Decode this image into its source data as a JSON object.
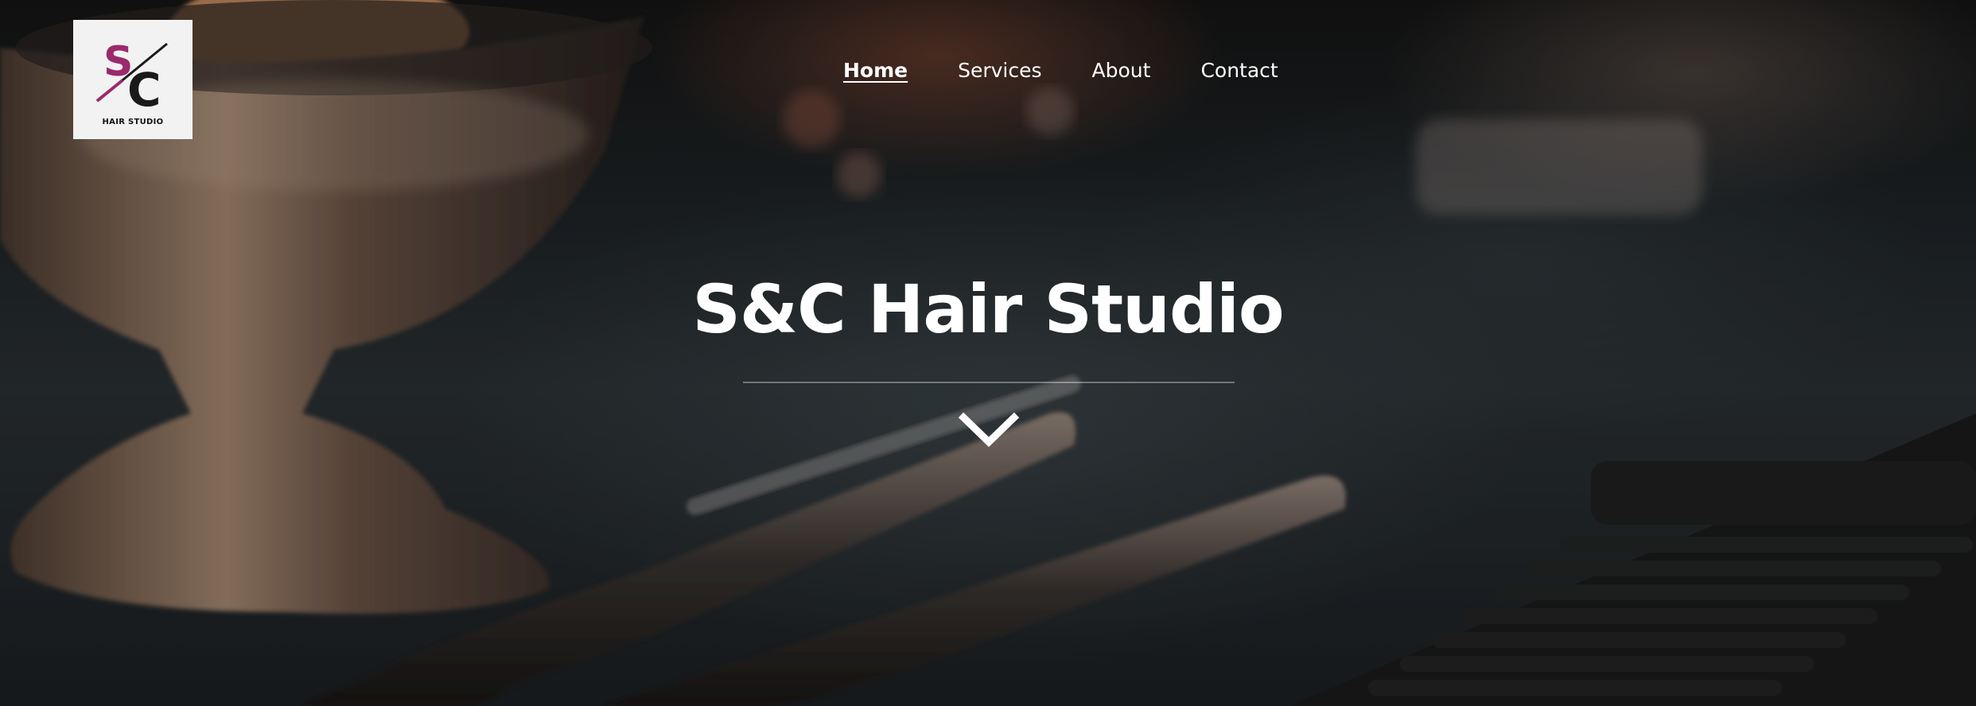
{
  "logo": {
    "letters": "S/C",
    "subtitle": "HAIR STUDIO",
    "accent_color": "#9b2a6c"
  },
  "nav": {
    "items": [
      {
        "label": "Home",
        "active": true
      },
      {
        "label": "Services",
        "active": false
      },
      {
        "label": "About",
        "active": false
      },
      {
        "label": "Contact",
        "active": false
      }
    ]
  },
  "hero": {
    "title": "S&C Hair Studio",
    "scroll_icon": "chevron-down-icon"
  },
  "colors": {
    "text": "#ffffff",
    "logo_bg": "#f2f2f2"
  }
}
